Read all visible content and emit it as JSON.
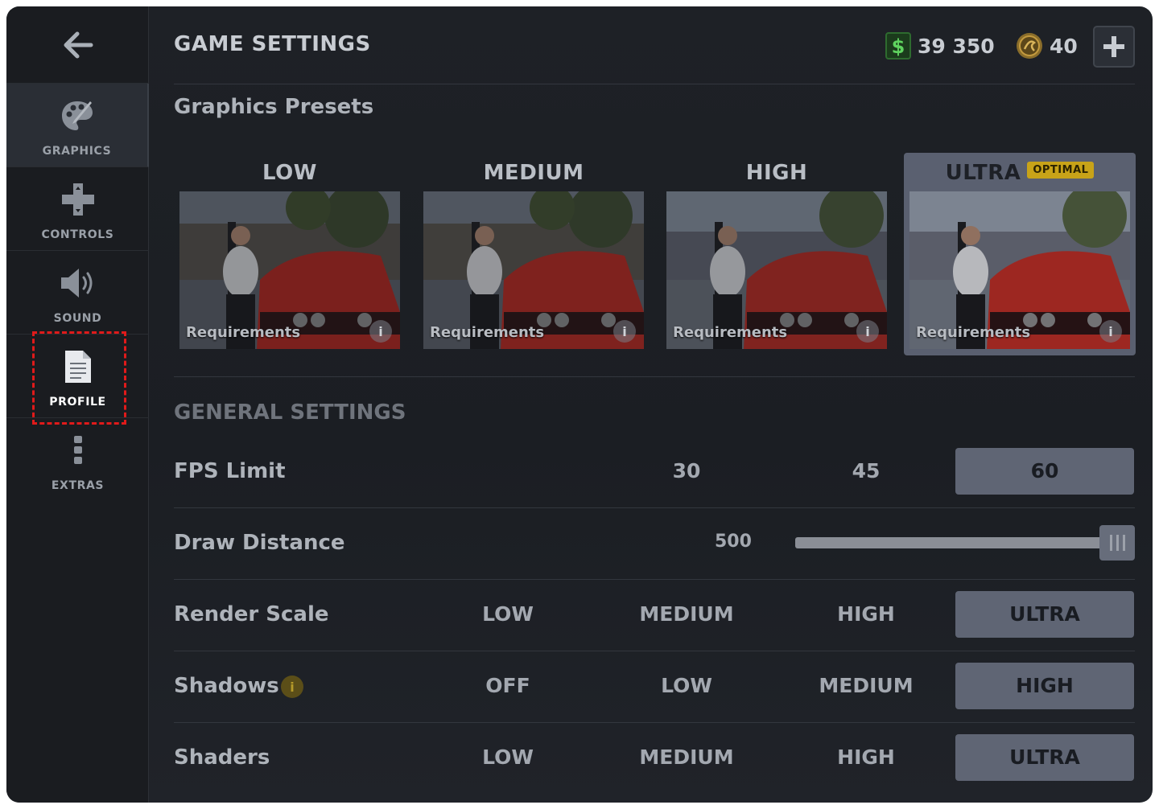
{
  "header": {
    "title": "GAME SETTINGS",
    "cash": "39 350",
    "coins": "40"
  },
  "sidebar": {
    "items": [
      {
        "label": "GRAPHICS",
        "icon": "palette-icon"
      },
      {
        "label": "CONTROLS",
        "icon": "dpad-icon"
      },
      {
        "label": "SOUND",
        "icon": "speaker-icon"
      },
      {
        "label": "PROFILE",
        "icon": "document-icon"
      },
      {
        "label": "EXTRAS",
        "icon": "more-vertical-icon"
      }
    ],
    "active": "GRAPHICS",
    "highlighted": "PROFILE"
  },
  "presets": {
    "title": "Graphics Presets",
    "requirements_label": "Requirements",
    "info_glyph": "i",
    "items": [
      {
        "name": "LOW"
      },
      {
        "name": "MEDIUM"
      },
      {
        "name": "HIGH"
      },
      {
        "name": "ULTRA",
        "badge": "OPTIMAL"
      }
    ],
    "selected": "ULTRA"
  },
  "general": {
    "title": "GENERAL SETTINGS",
    "fps": {
      "label": "FPS Limit",
      "options": [
        "30",
        "45",
        "60"
      ],
      "selected": "60"
    },
    "draw_distance": {
      "label": "Draw Distance",
      "value": "500",
      "fraction": 1.0
    },
    "render_scale": {
      "label": "Render Scale",
      "options": [
        "LOW",
        "MEDIUM",
        "HIGH",
        "ULTRA"
      ],
      "selected": "ULTRA"
    },
    "shadows": {
      "label": "Shadows",
      "info_glyph": "i",
      "options": [
        "OFF",
        "LOW",
        "MEDIUM",
        "HIGH"
      ],
      "selected": "HIGH"
    },
    "shaders": {
      "label": "Shaders",
      "options": [
        "LOW",
        "MEDIUM",
        "HIGH",
        "ULTRA"
      ],
      "selected": "ULTRA"
    }
  },
  "colors": {
    "accent_badge": "#c8a318",
    "selected_option": "#5f6574",
    "highlight_border": "#e01a1a"
  }
}
